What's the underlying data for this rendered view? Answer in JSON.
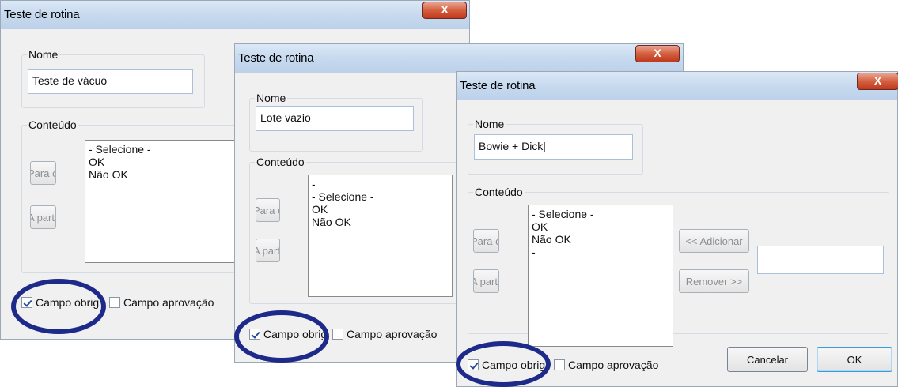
{
  "colors": {
    "title_gradient": "#c5d8ee",
    "close_red": "#d4603f",
    "highlight_ring": "#1d2a8a"
  },
  "dialogs": [
    {
      "title": "Teste de rotina",
      "close_label": "X",
      "nome_legend": "Nome",
      "nome_value": "Teste de vácuo",
      "conteudo_legend": "Conteúdo",
      "up_button": "Para cima",
      "start_button": "A partir de",
      "list_items": [
        "- Selecione -",
        "OK",
        "Não OK"
      ],
      "required_label": "Campo obrig",
      "required_checked": true,
      "approval_label": "Campo aprovação",
      "approval_checked": false
    },
    {
      "title": "Teste de rotina",
      "close_label": "X",
      "nome_legend": "Nome",
      "nome_value": "Lote vazio",
      "conteudo_legend": "Conteúdo",
      "up_button": "Para cima",
      "start_button": "A partir de",
      "list_items": [
        "-",
        "- Selecione -",
        "OK",
        "Não OK"
      ],
      "required_label": "Campo obrig",
      "required_checked": true,
      "approval_label": "Campo aprovação",
      "approval_checked": false
    },
    {
      "title": "Teste de rotina",
      "close_label": "X",
      "nome_legend": "Nome",
      "nome_value": "Bowie + Dick|",
      "conteudo_legend": "Conteúdo",
      "up_button": "Para cima",
      "start_button": "A partir de",
      "list_items": [
        "- Selecione -",
        "OK",
        "Não OK",
        "-"
      ],
      "add_button": "<< Adicionar",
      "remove_button": "Remover >>",
      "required_label": "Campo obrig",
      "required_checked": true,
      "approval_label": "Campo aprovação",
      "approval_checked": false,
      "cancel_button": "Cancelar",
      "ok_button": "OK"
    }
  ]
}
